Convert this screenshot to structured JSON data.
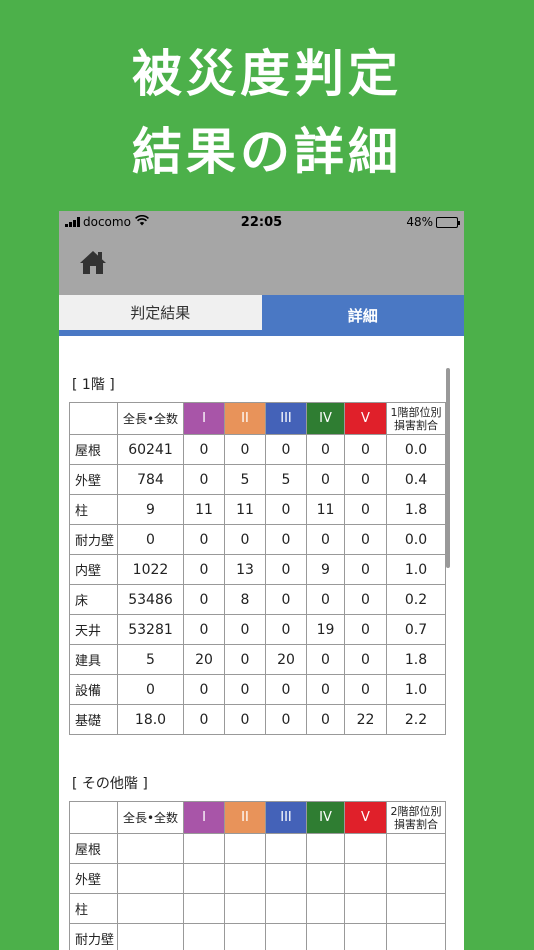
{
  "promo": {
    "line1": "被災度判定",
    "line2": "結果の詳細"
  },
  "status_bar": {
    "carrier": "docomo",
    "time": "22:05",
    "battery": "48%",
    "battery_level": 0.48
  },
  "tabs": [
    {
      "label": "判定結果",
      "active": false
    },
    {
      "label": "詳細",
      "active": true
    }
  ],
  "headers": {
    "length": "全長•全数",
    "grades": [
      {
        "label": "I",
        "color": "#a855a8"
      },
      {
        "label": "II",
        "color": "#e8935a"
      },
      {
        "label": "III",
        "color": "#4462b8"
      },
      {
        "label": "IV",
        "color": "#2f7d32"
      },
      {
        "label": "V",
        "color": "#e0202a"
      }
    ]
  },
  "floor1": {
    "title": "[ 1階 ]",
    "ratio_header_l1": "1階部位別",
    "ratio_header_l2": "損害割合",
    "rows": [
      {
        "part": "屋根",
        "length": "60241",
        "g1": "0",
        "g2": "0",
        "g3": "0",
        "g4": "0",
        "g5": "0",
        "ratio": "0.0"
      },
      {
        "part": "外壁",
        "length": "784",
        "g1": "0",
        "g2": "5",
        "g3": "5",
        "g4": "0",
        "g5": "0",
        "ratio": "0.4"
      },
      {
        "part": "柱",
        "length": "9",
        "g1": "11",
        "g2": "11",
        "g3": "0",
        "g4": "11",
        "g5": "0",
        "ratio": "1.8"
      },
      {
        "part": "耐力壁",
        "length": "0",
        "g1": "0",
        "g2": "0",
        "g3": "0",
        "g4": "0",
        "g5": "0",
        "ratio": "0.0"
      },
      {
        "part": "内壁",
        "length": "1022",
        "g1": "0",
        "g2": "13",
        "g3": "0",
        "g4": "9",
        "g5": "0",
        "ratio": "1.0"
      },
      {
        "part": "床",
        "length": "53486",
        "g1": "0",
        "g2": "8",
        "g3": "0",
        "g4": "0",
        "g5": "0",
        "ratio": "0.2"
      },
      {
        "part": "天井",
        "length": "53281",
        "g1": "0",
        "g2": "0",
        "g3": "0",
        "g4": "19",
        "g5": "0",
        "ratio": "0.7"
      },
      {
        "part": "建具",
        "length": "5",
        "g1": "20",
        "g2": "0",
        "g3": "20",
        "g4": "0",
        "g5": "0",
        "ratio": "1.8"
      },
      {
        "part": "設備",
        "length": "0",
        "g1": "0",
        "g2": "0",
        "g3": "0",
        "g4": "0",
        "g5": "0",
        "ratio": "1.0"
      },
      {
        "part": "基礎",
        "length": "18.0",
        "g1": "0",
        "g2": "0",
        "g3": "0",
        "g4": "0",
        "g5": "22",
        "ratio": "2.2"
      }
    ]
  },
  "other_floors": {
    "title": "[ その他階 ]",
    "ratio_header_l1": "2階部位別",
    "ratio_header_l2": "損害割合",
    "rows": [
      {
        "part": "屋根"
      },
      {
        "part": "外壁"
      },
      {
        "part": "柱"
      },
      {
        "part": "耐力壁"
      }
    ]
  }
}
